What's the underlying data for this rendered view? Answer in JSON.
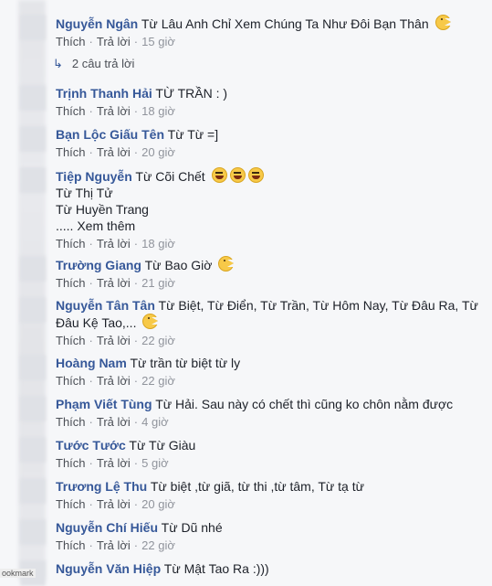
{
  "ui": {
    "like_label": "Thích",
    "reply_label": "Trả lời",
    "dot": "·",
    "see_more": "Xem thêm",
    "bookmark_label": "ookmark"
  },
  "comments": [
    {
      "author": "Nguyễn Ngân",
      "text": "Từ Lâu Anh Chỉ Xem Chúng Ta Như Đôi Bạn Thân",
      "emoji": "pacman-emoji",
      "time": "15 giờ"
    },
    {
      "author": "Trịnh Thanh Hải",
      "text": "TỪ TRẦN : )",
      "time": "18 giờ"
    },
    {
      "author": "Bạn Lộc Giấu Tên",
      "text": "Từ Từ =]",
      "time": "20 giờ"
    },
    {
      "author": "Tiệp Nguyễn",
      "text": "Từ Cõi Chết",
      "emoji": "laughing-emoji x3",
      "line2": "Từ Thị Tử",
      "line3": "Từ Huyền Trang",
      "line4_prefix": "..... ",
      "time": "18 giờ"
    },
    {
      "author": "Trường Giang",
      "text": "Từ Bao Giờ",
      "emoji": "pacman-emoji",
      "time": "21 giờ"
    },
    {
      "author": "Nguyễn Tân Tân",
      "text": "Từ Biệt, Từ Điển, Từ Trần, Từ Hôm Nay, Từ Đâu Ra, Từ",
      "line2": "Đâu Kệ Tao,...",
      "emoji": "pacman-emoji",
      "time": "22 giờ"
    },
    {
      "author": "Hoàng Nam",
      "text": "Từ trần từ biệt từ ly",
      "time": "22 giờ"
    },
    {
      "author": "Phạm Viết Tùng",
      "text": "Từ Hải. Sau này có chết thì cũng ko chôn nằm được",
      "time": "4 giờ"
    },
    {
      "author": "Tước Tước",
      "text": "Từ Từ Giàu",
      "time": "5 giờ"
    },
    {
      "author": "Trương Lệ Thu",
      "text": "Từ biệt ,từ giã, từ thi ,từ tâm, Từ tạ từ",
      "time": "20 giờ"
    },
    {
      "author": "Nguyễn Chí Hiếu",
      "text": "Từ Dũ nhé",
      "time": "22 giờ"
    },
    {
      "author": "Nguyễn Văn Hiệp",
      "text": "Từ Mật Tao Ra :)))"
    }
  ],
  "replies": {
    "icon": "reply-arrow-icon",
    "label": "2 câu trả lời"
  }
}
